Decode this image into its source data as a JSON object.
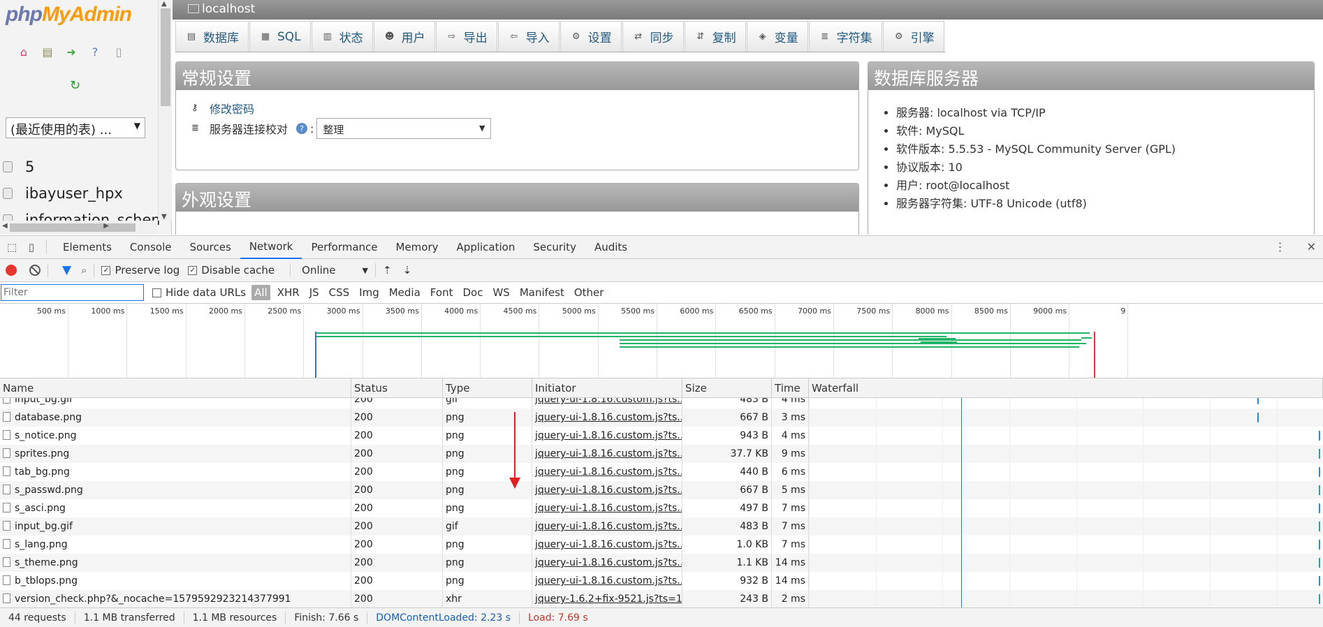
{
  "pma": {
    "logo": {
      "php": "php",
      "my": "My",
      "admin": "Admin"
    },
    "nav_icons": [
      "home-icon",
      "database-icon",
      "logout-icon",
      "help-icon",
      "docs-icon"
    ],
    "recent_tables": "(最近使用的表) ...",
    "databases": [
      "5",
      "ibayuser_hpx",
      "information_schema"
    ],
    "server_title": "localhost",
    "tabs": [
      {
        "label": "数据库",
        "icon": "database-icon"
      },
      {
        "label": "SQL",
        "icon": "sql-icon"
      },
      {
        "label": "状态",
        "icon": "status-icon"
      },
      {
        "label": "用户",
        "icon": "users-icon"
      },
      {
        "label": "导出",
        "icon": "export-icon"
      },
      {
        "label": "导入",
        "icon": "import-icon"
      },
      {
        "label": "设置",
        "icon": "settings-icon"
      },
      {
        "label": "同步",
        "icon": "sync-icon"
      },
      {
        "label": "复制",
        "icon": "replication-icon"
      },
      {
        "label": "变量",
        "icon": "variables-icon"
      },
      {
        "label": "字符集",
        "icon": "charset-icon"
      },
      {
        "label": "引擎",
        "icon": "engine-icon"
      }
    ],
    "general": {
      "title": "常规设置",
      "change_password": "修改密码",
      "collation_label": "服务器连接校对",
      "collation_colon": ":",
      "collation_value": "整理"
    },
    "appearance": {
      "title": "外观设置"
    },
    "server": {
      "title": "数据库服务器",
      "items": [
        "服务器: localhost via TCP/IP",
        "软件: MySQL",
        "软件版本: 5.5.53 - MySQL Community Server (GPL)",
        "协议版本: 10",
        "用户: root@localhost",
        "服务器字符集: UTF-8 Unicode (utf8)"
      ]
    }
  },
  "devtools": {
    "tabs": [
      "Elements",
      "Console",
      "Sources",
      "Network",
      "Performance",
      "Memory",
      "Application",
      "Security",
      "Audits"
    ],
    "active_tab": "Network",
    "preserve_log": "Preserve log",
    "disable_cache": "Disable cache",
    "throttle": "Online",
    "filter_placeholder": "Filter",
    "hide_data_urls": "Hide data URLs",
    "filter_types": [
      "All",
      "XHR",
      "JS",
      "CSS",
      "Img",
      "Media",
      "Font",
      "Doc",
      "WS",
      "Manifest",
      "Other"
    ],
    "timeline_ticks": [
      "500 ms",
      "1000 ms",
      "1500 ms",
      "2000 ms",
      "2500 ms",
      "3000 ms",
      "3500 ms",
      "4000 ms",
      "4500 ms",
      "5000 ms",
      "5500 ms",
      "6000 ms",
      "6500 ms",
      "7000 ms",
      "7500 ms",
      "8000 ms",
      "8500 ms",
      "9000 ms",
      "9"
    ],
    "columns": [
      "Name",
      "Status",
      "Type",
      "Initiator",
      "Size",
      "Time",
      "Waterfall"
    ],
    "rows": [
      {
        "name": "input_bg.gif",
        "status": "200",
        "type": "gif",
        "initiator": "jquery-ui-1.8.16.custom.js?ts...",
        "size": "483 B",
        "time": "4 ms"
      },
      {
        "name": "database.png",
        "status": "200",
        "type": "png",
        "initiator": "jquery-ui-1.8.16.custom.js?ts...",
        "size": "667 B",
        "time": "3 ms"
      },
      {
        "name": "s_notice.png",
        "status": "200",
        "type": "png",
        "initiator": "jquery-ui-1.8.16.custom.js?ts...",
        "size": "943 B",
        "time": "4 ms"
      },
      {
        "name": "sprites.png",
        "status": "200",
        "type": "png",
        "initiator": "jquery-ui-1.8.16.custom.js?ts...",
        "size": "37.7 KB",
        "time": "9 ms"
      },
      {
        "name": "tab_bg.png",
        "status": "200",
        "type": "png",
        "initiator": "jquery-ui-1.8.16.custom.js?ts...",
        "size": "440 B",
        "time": "6 ms"
      },
      {
        "name": "s_passwd.png",
        "status": "200",
        "type": "png",
        "initiator": "jquery-ui-1.8.16.custom.js?ts...",
        "size": "667 B",
        "time": "5 ms"
      },
      {
        "name": "s_asci.png",
        "status": "200",
        "type": "png",
        "initiator": "jquery-ui-1.8.16.custom.js?ts...",
        "size": "497 B",
        "time": "7 ms"
      },
      {
        "name": "input_bg.gif",
        "status": "200",
        "type": "gif",
        "initiator": "jquery-ui-1.8.16.custom.js?ts...",
        "size": "483 B",
        "time": "7 ms"
      },
      {
        "name": "s_lang.png",
        "status": "200",
        "type": "png",
        "initiator": "jquery-ui-1.8.16.custom.js?ts...",
        "size": "1.0 KB",
        "time": "7 ms"
      },
      {
        "name": "s_theme.png",
        "status": "200",
        "type": "png",
        "initiator": "jquery-ui-1.8.16.custom.js?ts...",
        "size": "1.1 KB",
        "time": "14 ms"
      },
      {
        "name": "b_tblops.png",
        "status": "200",
        "type": "png",
        "initiator": "jquery-ui-1.8.16.custom.js?ts...",
        "size": "932 B",
        "time": "14 ms"
      },
      {
        "name": "version_check.php?&_nocache=1579592923214377991",
        "status": "200",
        "type": "xhr",
        "initiator": "jquery-1.6.2+fix-9521.js?ts=1...",
        "size": "243 B",
        "time": "2 ms"
      }
    ],
    "status": {
      "requests": "44 requests",
      "transferred": "1.1 MB transferred",
      "resources": "1.1 MB resources",
      "finish": "Finish: 7.66 s",
      "dcl": "DOMContentLoaded: 2.23 s",
      "load": "Load: 7.69 s"
    },
    "colors": {
      "accent": "#1a73e8",
      "green": "#1fb466",
      "red": "#e02020"
    }
  }
}
